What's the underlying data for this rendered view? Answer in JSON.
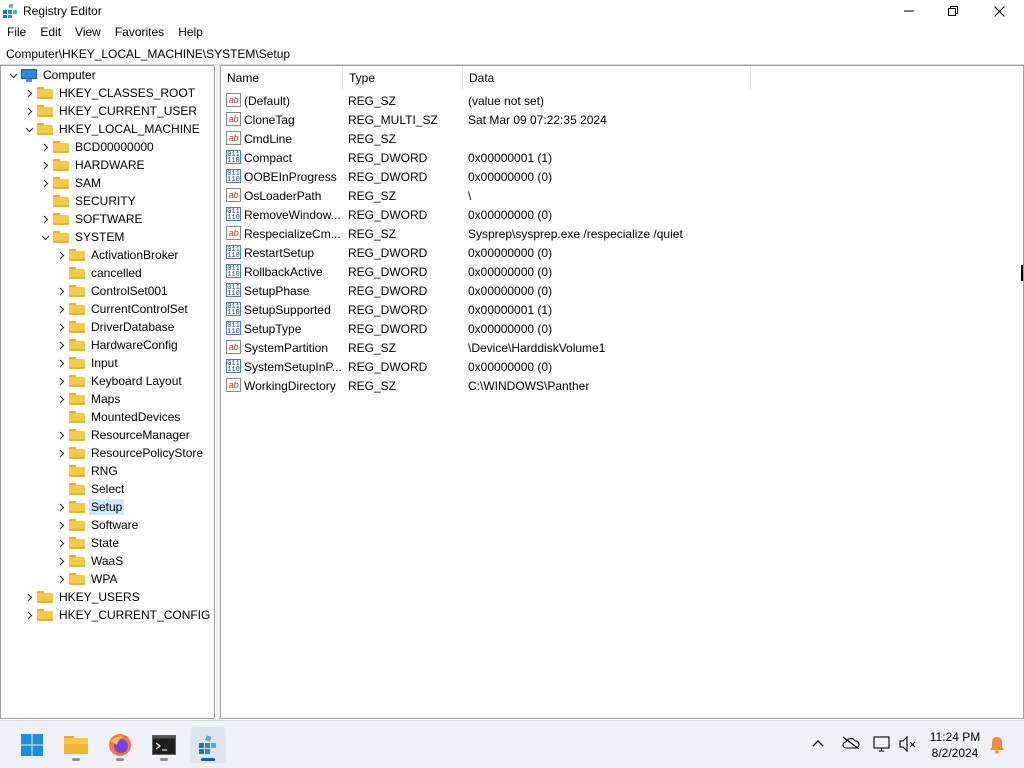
{
  "window": {
    "title": "Registry Editor"
  },
  "menu": [
    "File",
    "Edit",
    "View",
    "Favorites",
    "Help"
  ],
  "address": "Computer\\HKEY_LOCAL_MACHINE\\SYSTEM\\Setup",
  "tree": [
    {
      "label": "Computer",
      "depth": 0,
      "expander": "open",
      "icon": "computer-icon"
    },
    {
      "label": "HKEY_CLASSES_ROOT",
      "depth": 1,
      "expander": "closed"
    },
    {
      "label": "HKEY_CURRENT_USER",
      "depth": 1,
      "expander": "closed"
    },
    {
      "label": "HKEY_LOCAL_MACHINE",
      "depth": 1,
      "expander": "open"
    },
    {
      "label": "BCD00000000",
      "depth": 2,
      "expander": "closed"
    },
    {
      "label": "HARDWARE",
      "depth": 2,
      "expander": "closed"
    },
    {
      "label": "SAM",
      "depth": 2,
      "expander": "closed"
    },
    {
      "label": "SECURITY",
      "depth": 2,
      "expander": "none"
    },
    {
      "label": "SOFTWARE",
      "depth": 2,
      "expander": "closed"
    },
    {
      "label": "SYSTEM",
      "depth": 2,
      "expander": "open"
    },
    {
      "label": "ActivationBroker",
      "depth": 3,
      "expander": "closed"
    },
    {
      "label": "cancelled",
      "depth": 3,
      "expander": "none"
    },
    {
      "label": "ControlSet001",
      "depth": 3,
      "expander": "closed"
    },
    {
      "label": "CurrentControlSet",
      "depth": 3,
      "expander": "closed"
    },
    {
      "label": "DriverDatabase",
      "depth": 3,
      "expander": "closed"
    },
    {
      "label": "HardwareConfig",
      "depth": 3,
      "expander": "closed"
    },
    {
      "label": "Input",
      "depth": 3,
      "expander": "closed"
    },
    {
      "label": "Keyboard Layout",
      "depth": 3,
      "expander": "closed"
    },
    {
      "label": "Maps",
      "depth": 3,
      "expander": "closed"
    },
    {
      "label": "MountedDevices",
      "depth": 3,
      "expander": "none"
    },
    {
      "label": "ResourceManager",
      "depth": 3,
      "expander": "closed"
    },
    {
      "label": "ResourcePolicyStore",
      "depth": 3,
      "expander": "closed"
    },
    {
      "label": "RNG",
      "depth": 3,
      "expander": "none"
    },
    {
      "label": "Select",
      "depth": 3,
      "expander": "none"
    },
    {
      "label": "Setup",
      "depth": 3,
      "expander": "closed",
      "selected": true
    },
    {
      "label": "Software",
      "depth": 3,
      "expander": "closed"
    },
    {
      "label": "State",
      "depth": 3,
      "expander": "closed"
    },
    {
      "label": "WaaS",
      "depth": 3,
      "expander": "closed"
    },
    {
      "label": "WPA",
      "depth": 3,
      "expander": "closed"
    },
    {
      "label": "HKEY_USERS",
      "depth": 1,
      "expander": "closed"
    },
    {
      "label": "HKEY_CURRENT_CONFIG",
      "depth": 1,
      "expander": "closed"
    }
  ],
  "columns": {
    "name": "Name",
    "type": "Type",
    "data": "Data"
  },
  "values": [
    {
      "name": "(Default)",
      "type": "REG_SZ",
      "data": "(value not set)",
      "icon": "string-value-icon"
    },
    {
      "name": "CloneTag",
      "type": "REG_MULTI_SZ",
      "data": "Sat Mar 09 07:22:35 2024",
      "icon": "string-value-icon"
    },
    {
      "name": "CmdLine",
      "type": "REG_SZ",
      "data": "",
      "icon": "string-value-icon"
    },
    {
      "name": "Compact",
      "type": "REG_DWORD",
      "data": "0x00000001 (1)",
      "icon": "binary-value-icon"
    },
    {
      "name": "OOBEInProgress",
      "type": "REG_DWORD",
      "data": "0x00000000 (0)",
      "icon": "binary-value-icon"
    },
    {
      "name": "OsLoaderPath",
      "type": "REG_SZ",
      "data": "\\",
      "icon": "string-value-icon"
    },
    {
      "name": "RemoveWindow...",
      "type": "REG_DWORD",
      "data": "0x00000000 (0)",
      "icon": "binary-value-icon"
    },
    {
      "name": "RespecializeCm...",
      "type": "REG_SZ",
      "data": "Sysprep\\sysprep.exe /respecialize /quiet",
      "icon": "string-value-icon"
    },
    {
      "name": "RestartSetup",
      "type": "REG_DWORD",
      "data": "0x00000000 (0)",
      "icon": "binary-value-icon"
    },
    {
      "name": "RollbackActive",
      "type": "REG_DWORD",
      "data": "0x00000000 (0)",
      "icon": "binary-value-icon"
    },
    {
      "name": "SetupPhase",
      "type": "REG_DWORD",
      "data": "0x00000000 (0)",
      "icon": "binary-value-icon"
    },
    {
      "name": "SetupSupported",
      "type": "REG_DWORD",
      "data": "0x00000001 (1)",
      "icon": "binary-value-icon"
    },
    {
      "name": "SetupType",
      "type": "REG_DWORD",
      "data": "0x00000000 (0)",
      "icon": "binary-value-icon"
    },
    {
      "name": "SystemPartition",
      "type": "REG_SZ",
      "data": "\\Device\\HarddiskVolume1",
      "icon": "string-value-icon"
    },
    {
      "name": "SystemSetupInP...",
      "type": "REG_DWORD",
      "data": "0x00000000 (0)",
      "icon": "binary-value-icon"
    },
    {
      "name": "WorkingDirectory",
      "type": "REG_SZ",
      "data": "C:\\WINDOWS\\Panther",
      "icon": "string-value-icon"
    }
  ],
  "taskbar": {
    "apps": [
      "start-icon",
      "file-explorer-icon",
      "firefox-icon",
      "terminal-icon",
      "registry-editor-icon"
    ],
    "active_app": "registry-editor-icon",
    "tray": [
      "show-hidden-icons-chevron",
      "cloud-offline-icon",
      "network-icon",
      "volume-muted-icon",
      "notification-bell-icon"
    ],
    "time": "11:24 PM",
    "date": "8/2/2024"
  }
}
